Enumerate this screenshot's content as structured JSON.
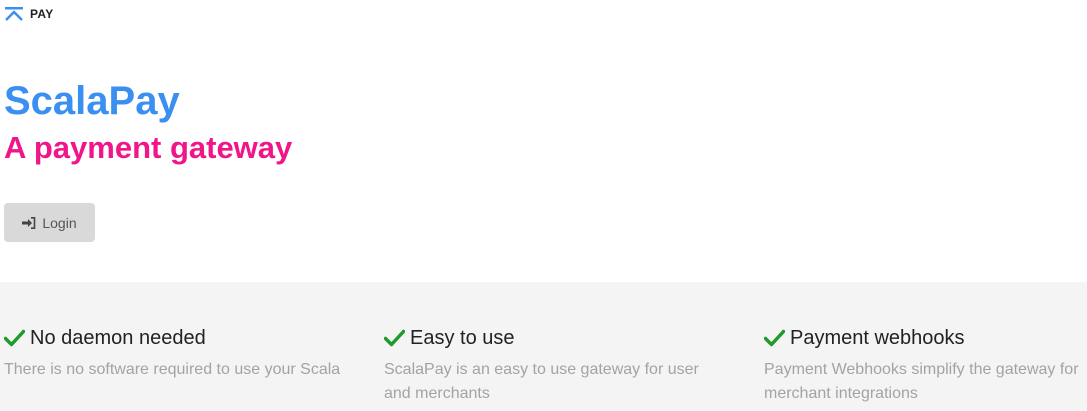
{
  "brand": {
    "logo_text": "PAY",
    "logo_color": "#3a8ff0"
  },
  "hero": {
    "title": "ScalaPay",
    "subtitle": "A payment gateway",
    "title_color": "#3a8ff0",
    "subtitle_color": "#f0168a"
  },
  "login": {
    "label": "Login",
    "icon": "sign-in-icon"
  },
  "features": [
    {
      "icon": "check-icon",
      "title": "No daemon needed",
      "description": "There is no software required to use your Scala"
    },
    {
      "icon": "check-icon",
      "title": "Easy to use",
      "description": "ScalaPay is an easy to use gateway for user and merchants"
    },
    {
      "icon": "check-icon",
      "title": "Payment webhooks",
      "description": "Payment Webhooks simplify the gateway for merchant integrations"
    }
  ],
  "colors": {
    "check": "#1f9b2e",
    "features_bg": "#f4f4f4"
  }
}
